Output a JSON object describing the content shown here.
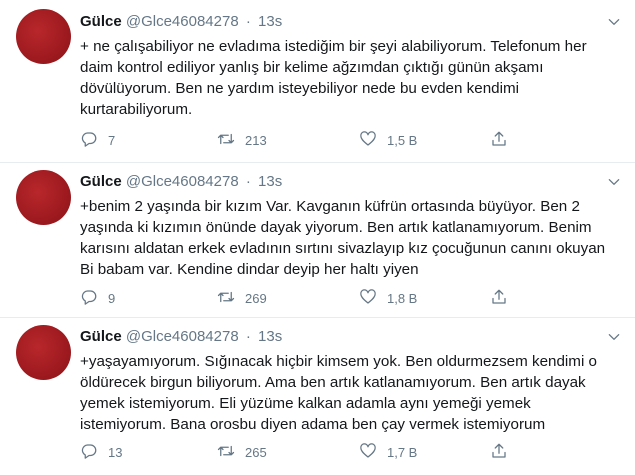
{
  "tweets": [
    {
      "name": "Gülce",
      "handle": "@Glce46084278",
      "separator": "·",
      "time": "13s",
      "lines": [
        "+ ne çalışabiliyor ne evladıma istediğim bir şeyi alabiliyorum. Telefonum her",
        "daim kontrol ediliyor yanlış bir kelime ağzımdan çıktığı günün akşamı",
        "dövülüyorum. Ben ne yardım isteyebiliyor nede bu evden kendimi",
        "kurtarabiliyorum."
      ],
      "replies": "7",
      "retweets": "213",
      "likes": "1,5 B"
    },
    {
      "name": "Gülce",
      "handle": "@Glce46084278",
      "separator": "·",
      "time": "13s",
      "lines": [
        "+benim 2 yaşında bir kızım  Var. Kavganın küfrün ortasında büyüyor. Ben 2",
        "yaşında ki kızımın önünde dayak yiyorum. Ben artık katlanamıyorum. Benim",
        "karısını aldatan erkek evladının sırtını sivazlayıp kız çocuğunun canını okuyan",
        "Bi babam var. Kendine dindar deyip her haltı yiyen"
      ],
      "replies": "9",
      "retweets": "269",
      "likes": "1,8 B"
    },
    {
      "name": "Gülce",
      "handle": "@Glce46084278",
      "separator": "·",
      "time": "13s",
      "lines": [
        "+yaşayamıyorum. Sığınacak hiçbir kimsem yok. Ben oldurmezsem kendimi o",
        "öldürecek birgun biliyorum. Ama ben artık katlanamıyorum. Ben artık dayak",
        "yemek istemiyorum. Eli yüzüme kalkan adamla aynı yemeği yemek",
        "istemiyorum. Bana orosbu diyen adama ben çay vermek istemiyorum"
      ],
      "replies": "13",
      "retweets": "265",
      "likes": "1,7 B"
    }
  ],
  "icons": {
    "reply": "reply-icon",
    "retweet": "retweet-icon",
    "like": "heart-icon",
    "share": "share-icon",
    "more": "chevron-down-icon"
  },
  "colors": {
    "text": "#14171a",
    "muted": "#657786",
    "avatar": "#9e1a1f",
    "divider": "#e6ecf0"
  }
}
